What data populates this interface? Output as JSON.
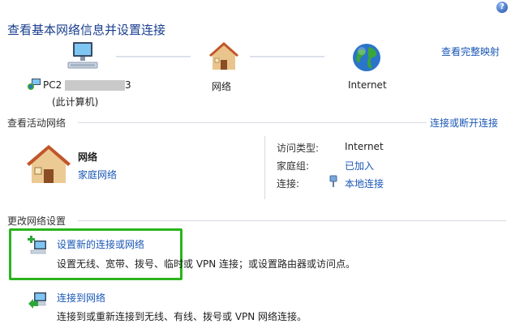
{
  "header": {
    "title": "查看基本网络信息并设置连接",
    "view_full_map": "查看完整映射",
    "help_glyph": "?"
  },
  "network_map": {
    "computer_name": "PC2",
    "computer_name_suffix": "3",
    "computer_sub": "(此计算机)",
    "network_label": "网络",
    "internet_label": "Internet"
  },
  "active_networks": {
    "section_title": "查看活动网络",
    "connect_disconnect": "连接或断开连接",
    "network_name": "网络",
    "network_type": "家庭网络",
    "access_type_label": "访问类型:",
    "access_type_value": "Internet",
    "homegroup_label": "家庭组:",
    "homegroup_value": "已加入",
    "connections_label": "连接:",
    "connections_value": "本地连接"
  },
  "change_settings": {
    "section_title": "更改网络设置",
    "items": [
      {
        "title": "设置新的连接或网络",
        "desc": "设置无线、宽带、拨号、临时或 VPN 连接；或设置路由器或访问点。"
      },
      {
        "title": "连接到网络",
        "desc": "连接到或重新连接到无线、有线、拨号或 VPN 网络连接。"
      }
    ]
  },
  "colors": {
    "link": "#1a57b6",
    "title": "#1a3e8e",
    "highlight": "#2bb41e"
  }
}
